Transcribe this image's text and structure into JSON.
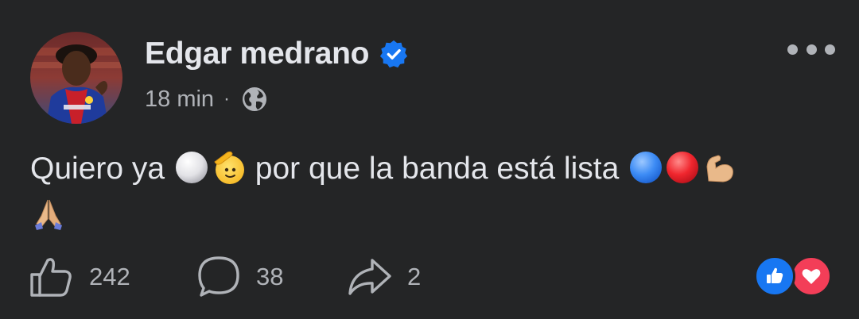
{
  "post": {
    "author": "Edgar medrano",
    "verified": true,
    "time": "18 min",
    "separator": "·",
    "audience_icon": "globe-icon",
    "text_parts": [
      "Quiero ya",
      "por que la banda está lista"
    ],
    "emojis": [
      "white-circle",
      "saluting-face",
      "blue-circle",
      "red-circle",
      "flexed-biceps",
      "folded-hands"
    ]
  },
  "actions": {
    "like_count": "242",
    "comment_count": "38",
    "share_count": "2"
  },
  "reactions": [
    "like-icon",
    "love-icon"
  ],
  "colors": {
    "background": "#242526",
    "text_primary": "#e4e6eb",
    "text_secondary": "#b0b3b8",
    "verified_blue": "#1877f2",
    "like_blue": "#1877f2",
    "love_red": "#f33e58"
  }
}
